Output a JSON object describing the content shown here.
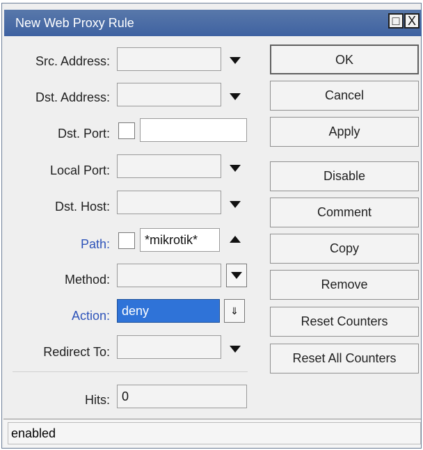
{
  "window": {
    "title": "New Web Proxy Rule",
    "controls": {
      "maximize": "□",
      "close": "X"
    }
  },
  "form": {
    "src_address": {
      "label": "Src. Address:",
      "value": ""
    },
    "dst_address": {
      "label": "Dst. Address:",
      "value": ""
    },
    "dst_port": {
      "label": "Dst. Port:",
      "value": ""
    },
    "local_port": {
      "label": "Local Port:",
      "value": ""
    },
    "dst_host": {
      "label": "Dst. Host:",
      "value": ""
    },
    "path": {
      "label": "Path:",
      "value": "*mikrotik*"
    },
    "method": {
      "label": "Method:",
      "value": ""
    },
    "action": {
      "label": "Action:",
      "value": "deny"
    },
    "redirect_to": {
      "label": "Redirect To:",
      "value": ""
    },
    "hits": {
      "label": "Hits:",
      "value": "0"
    }
  },
  "buttons": {
    "ok": "OK",
    "cancel": "Cancel",
    "apply": "Apply",
    "disable": "Disable",
    "comment": "Comment",
    "copy": "Copy",
    "remove": "Remove",
    "reset_counters": "Reset Counters",
    "reset_all_counters": "Reset All Counters"
  },
  "status": {
    "text": "enabled"
  },
  "icons": {
    "dropdown": "triangle-down",
    "collapse": "triangle-up",
    "action_picker": "list-arrow"
  }
}
